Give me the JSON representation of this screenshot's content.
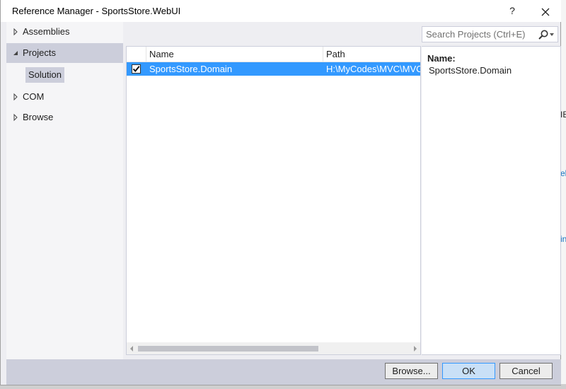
{
  "window": {
    "title": "Reference Manager - SportsStore.WebUI",
    "help_label": "?"
  },
  "nav": {
    "items": [
      {
        "label": "Assemblies",
        "expanded": false
      },
      {
        "label": "Projects",
        "expanded": true,
        "selected": true
      },
      {
        "label": "COM",
        "expanded": false
      },
      {
        "label": "Browse",
        "expanded": false
      }
    ],
    "sub_item": "Solution"
  },
  "search": {
    "placeholder": "Search Projects (Ctrl+E)"
  },
  "list": {
    "columns": [
      "Name",
      "Path"
    ],
    "rows": [
      {
        "checked": true,
        "name": "SportsStore.Domain",
        "path": "H:\\MyCodes\\MVC\\MVC"
      }
    ]
  },
  "details": {
    "label": "Name:",
    "value": "SportsStore.Domain"
  },
  "footer": {
    "browse_label": "Browse...",
    "ok_label": "OK",
    "cancel_label": "Cancel"
  },
  "backdrop": {
    "fragments": [
      "IE",
      "eb",
      "in"
    ]
  },
  "colors": {
    "selection": "#3399ff",
    "nav_selected": "#cccedb",
    "footer": "#cccedb"
  }
}
